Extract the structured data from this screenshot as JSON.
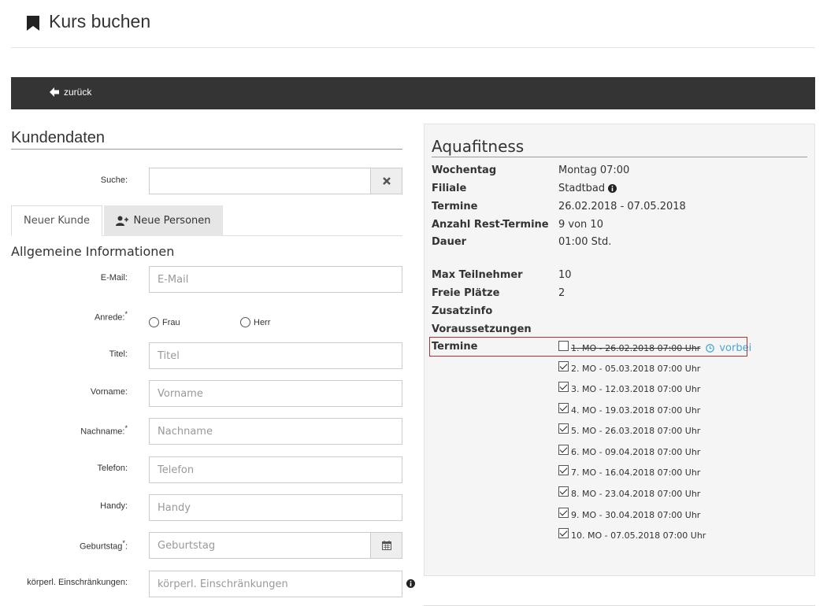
{
  "header": {
    "title": "Kurs buchen"
  },
  "toolbar": {
    "back_label": "zurück"
  },
  "customer": {
    "section_title": "Kundendaten",
    "search_label": "Suche:",
    "search_value": "",
    "tabs": [
      {
        "label": "Neuer Kunde",
        "active": true
      },
      {
        "label": "Neue Personen",
        "active": false
      }
    ],
    "sub_title": "Allgemeine Informationen",
    "fields": {
      "email": {
        "label": "E-Mail:",
        "placeholder": "E-Mail"
      },
      "anrede": {
        "label": "Anrede:",
        "options": [
          "Frau",
          "Herr"
        ]
      },
      "titel": {
        "label": "Titel:",
        "placeholder": "Titel"
      },
      "vorname": {
        "label": "Vorname:",
        "placeholder": "Vorname"
      },
      "nachname": {
        "label": "Nachname:",
        "placeholder": "Nachname"
      },
      "telefon": {
        "label": "Telefon:",
        "placeholder": "Telefon"
      },
      "handy": {
        "label": "Handy:",
        "placeholder": "Handy"
      },
      "geburtstag": {
        "label": "Geburtstag",
        "label_suffix": ":",
        "placeholder": "Geburtstag"
      },
      "einschraenkungen": {
        "label": "körperl. Einschränkungen:",
        "placeholder": "körperl. Einschränkungen"
      }
    },
    "required_mark": "*"
  },
  "course": {
    "title": "Aquafitness",
    "details": [
      {
        "label": "Wochentag",
        "value": "Montag 07:00"
      },
      {
        "label": "Filiale",
        "value": "Stadtbad"
      },
      {
        "label": "Termine",
        "value": "26.02.2018 - 07.05.2018"
      },
      {
        "label": "Anzahl Rest-Termine",
        "value": "9 von 10"
      },
      {
        "label": "Dauer",
        "value": "01:00 Std."
      }
    ],
    "details2": [
      {
        "label": "Max Teilnehmer",
        "value": "10"
      },
      {
        "label": "Freie Plätze",
        "value": "2"
      },
      {
        "label": "Zusatzinfo",
        "value": ""
      },
      {
        "label": "Voraussetzungen",
        "value": ""
      }
    ],
    "termine_label": "Termine",
    "termine": [
      {
        "text": "1. MO - 26.02.2018 07:00 Uhr",
        "checked": false,
        "past": true
      },
      {
        "text": "2. MO - 05.03.2018 07:00 Uhr",
        "checked": true
      },
      {
        "text": "3. MO - 12.03.2018 07:00 Uhr",
        "checked": true
      },
      {
        "text": "4. MO - 19.03.2018 07:00 Uhr",
        "checked": true
      },
      {
        "text": "5. MO - 26.03.2018 07:00 Uhr",
        "checked": true
      },
      {
        "text": "6. MO - 09.04.2018 07:00 Uhr",
        "checked": true
      },
      {
        "text": "7. MO - 16.04.2018 07:00 Uhr",
        "checked": true
      },
      {
        "text": "8. MO - 23.04.2018 07:00 Uhr",
        "checked": true
      },
      {
        "text": "9. MO - 30.04.2018 07:00 Uhr",
        "checked": true
      },
      {
        "text": "10. MO - 07.05.2018 07:00 Uhr",
        "checked": true
      }
    ],
    "past_label": "vorbei"
  },
  "icons": {
    "bookmark": "bookmark-icon",
    "back": "arrow-left-icon",
    "clear": "times-icon",
    "add_user": "user-plus-icon",
    "calendar": "calendar-icon",
    "info": "info-circle-icon",
    "clock": "clock-icon"
  }
}
